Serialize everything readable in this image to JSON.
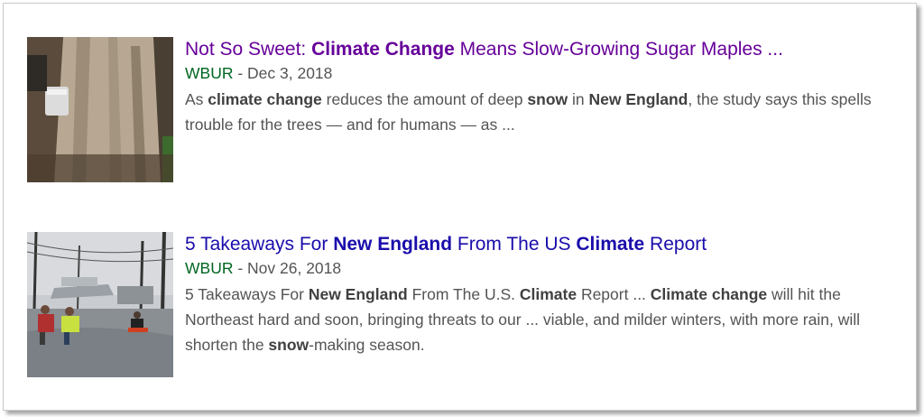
{
  "results": [
    {
      "title": {
        "part1": "Not So Sweet: ",
        "bold1": "Climate Change",
        "part2": " Means Slow-Growing Sugar Maples ..."
      },
      "source": "WBUR",
      "separator": " - ",
      "date": "Dec 3, 2018",
      "snippet": {
        "s1": "As ",
        "b1": "climate change",
        "s2": " reduces the amount of deep ",
        "b2": "snow",
        "s3": " in ",
        "b3": "New England",
        "s4": ", the study says this spells trouble for the trees — and for humans — as ..."
      },
      "thumbnail": "sugar-maple-tree-photo"
    },
    {
      "title": {
        "part1": "5 Takeaways For ",
        "bold1": "New England",
        "part2": " From The US ",
        "bold2": "Climate",
        "part3": " Report"
      },
      "source": "WBUR",
      "separator": " - ",
      "date": "Nov 26, 2018",
      "snippet": {
        "s1": "5 Takeaways For ",
        "b1": "New England",
        "s2": " From The U.S. ",
        "b2": "Climate",
        "s3": " Report ... ",
        "b3": "Climate change",
        "s4": " will hit the Northeast hard and soon, bringing threats to our ... viable, and milder winters, with more rain, will shorten the ",
        "b4": "snow",
        "s5": "-making season."
      },
      "thumbnail": "flooded-street-photo"
    }
  ],
  "colors": {
    "visited_link": "#660099",
    "link": "#1a0dab",
    "source": "#006621",
    "snippet": "#545454"
  }
}
